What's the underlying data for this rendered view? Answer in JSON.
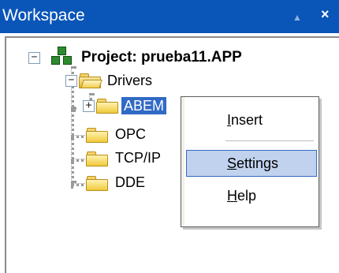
{
  "window": {
    "title": "Workspace",
    "up_icon": "up-arrow-icon",
    "close_icon": "close-icon"
  },
  "tree": {
    "project": {
      "label": "Project: prueba11.APP",
      "expander": "−",
      "icon": "project-cubes-icon"
    },
    "drivers": {
      "label": "Drivers",
      "expander": "−",
      "icon": "folder-open-icon"
    },
    "abem": {
      "label": "ABEM",
      "expander": "+",
      "icon": "folder-icon",
      "selected": true
    },
    "opc": {
      "label": "OPC",
      "icon": "folder-icon"
    },
    "tcpip": {
      "label": "TCP/IP",
      "icon": "folder-icon"
    },
    "dde": {
      "label": "DDE",
      "icon": "folder-icon"
    }
  },
  "context_menu": {
    "items": [
      {
        "label": "Insert",
        "hovered": false
      },
      {
        "label": "Settings",
        "hovered": true
      },
      {
        "label": "Help",
        "hovered": false
      }
    ]
  },
  "colors": {
    "titlebar": "#0a55b8",
    "selection": "#316ac5",
    "menu_hover": "#c1d2ee"
  }
}
